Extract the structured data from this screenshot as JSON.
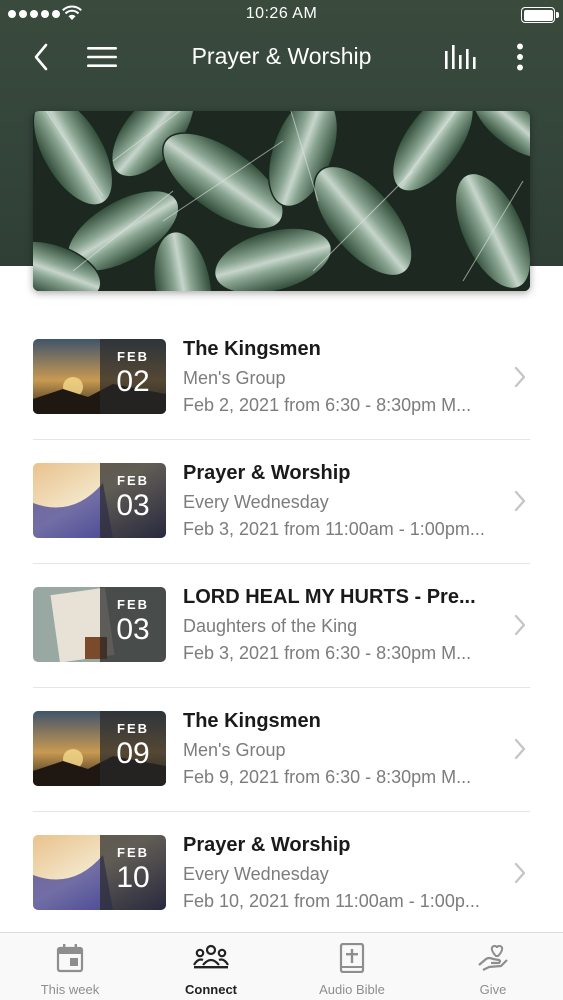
{
  "status_bar": {
    "time": "10:26 AM"
  },
  "nav": {
    "title": "Prayer & Worship"
  },
  "events": [
    {
      "month": "FEB",
      "day": "02",
      "title": "The Kingsmen",
      "subtitle": "Men's Group",
      "when": "Feb 2, 2021 from 6:30 - 8:30pm M...",
      "theme": "sunset"
    },
    {
      "month": "FEB",
      "day": "03",
      "title": "Prayer & Worship",
      "subtitle": "Every Wednesday",
      "when": "Feb 3, 2021 from 11:00am - 1:00pm...",
      "theme": "light"
    },
    {
      "month": "FEB",
      "day": "03",
      "title": "LORD HEAL MY HURTS - Pre...",
      "subtitle": "Daughters of the King",
      "when": "Feb 3, 2021 from 6:30 - 8:30pm M...",
      "theme": "book"
    },
    {
      "month": "FEB",
      "day": "09",
      "title": "The Kingsmen",
      "subtitle": "Men's Group",
      "when": "Feb 9, 2021 from 6:30 - 8:30pm M...",
      "theme": "sunset"
    },
    {
      "month": "FEB",
      "day": "10",
      "title": "Prayer & Worship",
      "subtitle": "Every Wednesday",
      "when": "Feb 10, 2021 from 11:00am - 1:00p...",
      "theme": "light"
    }
  ],
  "tabs": [
    {
      "label": "This week",
      "icon": "calendar-icon",
      "active": false
    },
    {
      "label": "Connect",
      "icon": "people-icon",
      "active": true
    },
    {
      "label": "Audio Bible",
      "icon": "bible-icon",
      "active": false
    },
    {
      "label": "Give",
      "icon": "hand-heart-icon",
      "active": false
    }
  ],
  "colors": {
    "header": "#33443a",
    "text_primary": "#1a1a1a",
    "text_secondary": "#7c7c7c",
    "tab_inactive": "#8e8e8e"
  }
}
